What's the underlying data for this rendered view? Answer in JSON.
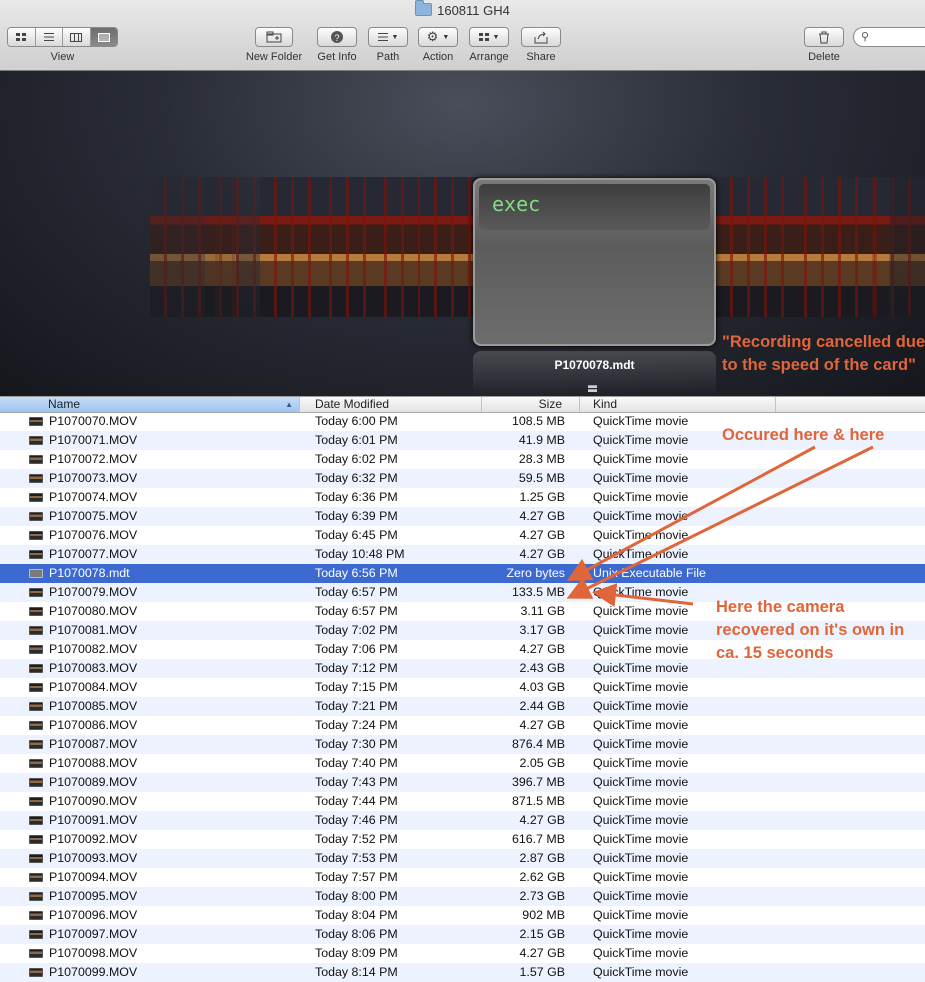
{
  "window": {
    "title": "160811 GH4"
  },
  "toolbar": {
    "view_label": "View",
    "new_folder_label": "New Folder",
    "get_info_label": "Get Info",
    "path_label": "Path",
    "action_label": "Action",
    "arrange_label": "Arrange",
    "share_label": "Share",
    "delete_label": "Delete"
  },
  "coverflow": {
    "selected_name": "P1070078.mdt",
    "preview_text": "exec"
  },
  "list": {
    "columns": {
      "name": "Name",
      "date": "Date Modified",
      "size": "Size",
      "kind": "Kind"
    },
    "selected_index": 8,
    "rows": [
      {
        "name": "P1070070.MOV",
        "date": "Today 6:00 PM",
        "size": "108.5 MB",
        "kind": "QuickTime movie"
      },
      {
        "name": "P1070071.MOV",
        "date": "Today 6:01 PM",
        "size": "41.9 MB",
        "kind": "QuickTime movie"
      },
      {
        "name": "P1070072.MOV",
        "date": "Today 6:02 PM",
        "size": "28.3 MB",
        "kind": "QuickTime movie"
      },
      {
        "name": "P1070073.MOV",
        "date": "Today 6:32 PM",
        "size": "59.5 MB",
        "kind": "QuickTime movie"
      },
      {
        "name": "P1070074.MOV",
        "date": "Today 6:36 PM",
        "size": "1.25 GB",
        "kind": "QuickTime movie"
      },
      {
        "name": "P1070075.MOV",
        "date": "Today 6:39 PM",
        "size": "4.27 GB",
        "kind": "QuickTime movie"
      },
      {
        "name": "P1070076.MOV",
        "date": "Today 6:45 PM",
        "size": "4.27 GB",
        "kind": "QuickTime movie"
      },
      {
        "name": "P1070077.MOV",
        "date": "Today 10:48 PM",
        "size": "4.27 GB",
        "kind": "QuickTime movie"
      },
      {
        "name": "P1070078.mdt",
        "date": "Today 6:56 PM",
        "size": "Zero bytes",
        "kind": "Unix Executable File"
      },
      {
        "name": "P1070079.MOV",
        "date": "Today 6:57 PM",
        "size": "133.5 MB",
        "kind": "QuickTime movie"
      },
      {
        "name": "P1070080.MOV",
        "date": "Today 6:57 PM",
        "size": "3.11 GB",
        "kind": "QuickTime movie"
      },
      {
        "name": "P1070081.MOV",
        "date": "Today 7:02 PM",
        "size": "3.17 GB",
        "kind": "QuickTime movie"
      },
      {
        "name": "P1070082.MOV",
        "date": "Today 7:06 PM",
        "size": "4.27 GB",
        "kind": "QuickTime movie"
      },
      {
        "name": "P1070083.MOV",
        "date": "Today 7:12 PM",
        "size": "2.43 GB",
        "kind": "QuickTime movie"
      },
      {
        "name": "P1070084.MOV",
        "date": "Today 7:15 PM",
        "size": "4.03 GB",
        "kind": "QuickTime movie"
      },
      {
        "name": "P1070085.MOV",
        "date": "Today 7:21 PM",
        "size": "2.44 GB",
        "kind": "QuickTime movie"
      },
      {
        "name": "P1070086.MOV",
        "date": "Today 7:24 PM",
        "size": "4.27 GB",
        "kind": "QuickTime movie"
      },
      {
        "name": "P1070087.MOV",
        "date": "Today 7:30 PM",
        "size": "876.4 MB",
        "kind": "QuickTime movie"
      },
      {
        "name": "P1070088.MOV",
        "date": "Today 7:40 PM",
        "size": "2.05 GB",
        "kind": "QuickTime movie"
      },
      {
        "name": "P1070089.MOV",
        "date": "Today 7:43 PM",
        "size": "396.7 MB",
        "kind": "QuickTime movie"
      },
      {
        "name": "P1070090.MOV",
        "date": "Today 7:44 PM",
        "size": "871.5 MB",
        "kind": "QuickTime movie"
      },
      {
        "name": "P1070091.MOV",
        "date": "Today 7:46 PM",
        "size": "4.27 GB",
        "kind": "QuickTime movie"
      },
      {
        "name": "P1070092.MOV",
        "date": "Today 7:52 PM",
        "size": "616.7 MB",
        "kind": "QuickTime movie"
      },
      {
        "name": "P1070093.MOV",
        "date": "Today 7:53 PM",
        "size": "2.87 GB",
        "kind": "QuickTime movie"
      },
      {
        "name": "P1070094.MOV",
        "date": "Today 7:57 PM",
        "size": "2.62 GB",
        "kind": "QuickTime movie"
      },
      {
        "name": "P1070095.MOV",
        "date": "Today 8:00 PM",
        "size": "2.73 GB",
        "kind": "QuickTime movie"
      },
      {
        "name": "P1070096.MOV",
        "date": "Today 8:04 PM",
        "size": "902 MB",
        "kind": "QuickTime movie"
      },
      {
        "name": "P1070097.MOV",
        "date": "Today 8:06 PM",
        "size": "2.15 GB",
        "kind": "QuickTime movie"
      },
      {
        "name": "P1070098.MOV",
        "date": "Today 8:09 PM",
        "size": "4.27 GB",
        "kind": "QuickTime movie"
      },
      {
        "name": "P1070099.MOV",
        "date": "Today 8:14 PM",
        "size": "1.57 GB",
        "kind": "QuickTime movie"
      }
    ]
  },
  "annotations": {
    "recording_cancelled": "\"Recording cancelled due to the speed of the card\"",
    "occurred_here": "Occured here & here",
    "camera_recovered": "Here the camera recovered on it's own in ca. 15 seconds",
    "color": "#e0653a"
  }
}
